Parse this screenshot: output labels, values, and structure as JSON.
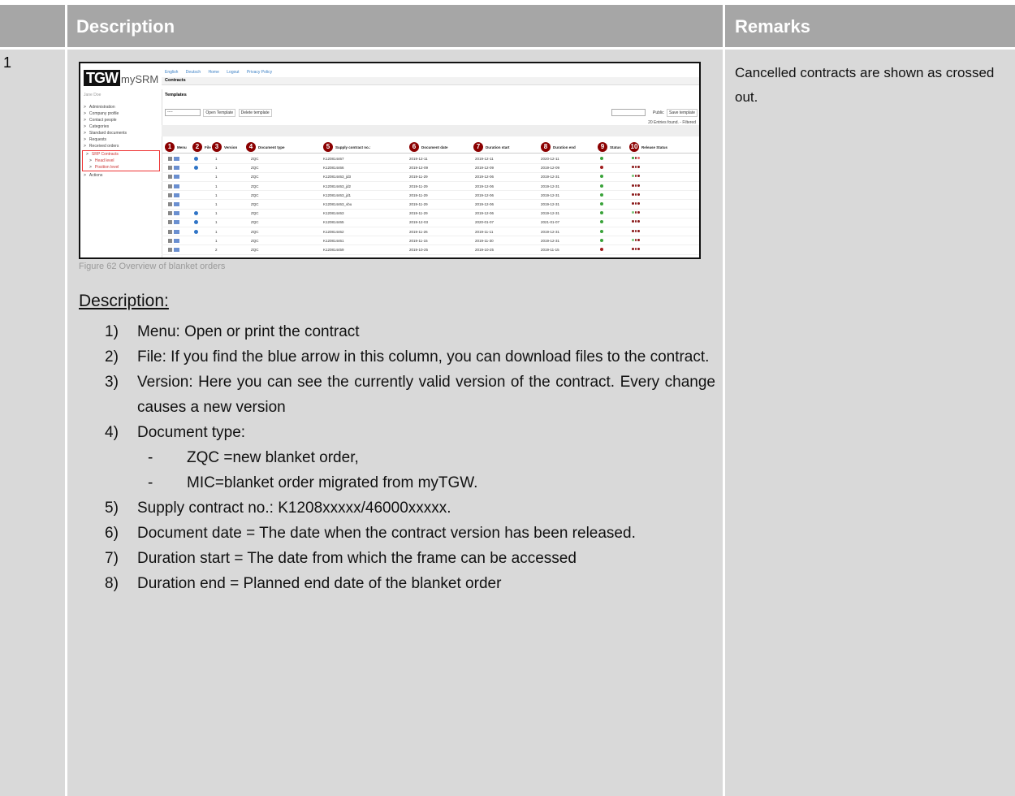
{
  "table": {
    "header_description": "Description",
    "header_remarks": "Remarks",
    "row_number": "1",
    "remark": "Cancelled contracts are shown as crossed out."
  },
  "screenshot": {
    "logo_tg": "TGW",
    "logo_my": "mySRM",
    "topnav": [
      "English",
      "Deutsch",
      "Home",
      "Logout",
      "Privacy Policy"
    ],
    "user": "Jane Doe",
    "sidebar": [
      "Administration",
      "Company profile",
      "Contact people",
      "Categories",
      "Standard documents",
      "Requests",
      "Received orders"
    ],
    "sidebar_box_title": "SRP Contracts",
    "sidebar_box_items": [
      "Head level",
      "Position level"
    ],
    "sidebar_after": "Actions",
    "contracts_title": "Contracts",
    "templates_title": "Templates",
    "select_value": "----",
    "open_template": "Open Template",
    "delete_template": "Delete template",
    "public_label": "Public",
    "save_template": "Save template",
    "entries_found": "20 Entries found. - Filtered",
    "columns": [
      {
        "badge": "1",
        "label": "Menu"
      },
      {
        "badge": "2",
        "label": "File"
      },
      {
        "badge": "3",
        "label": "Version"
      },
      {
        "badge": "4",
        "label": "Document type"
      },
      {
        "badge": "5",
        "label": "Supply contract no.:"
      },
      {
        "badge": "6",
        "label": "Document date"
      },
      {
        "badge": "7",
        "label": "Duration start"
      },
      {
        "badge": "8",
        "label": "Duration end"
      },
      {
        "badge": "9",
        "label": "Status"
      },
      {
        "badge": "10",
        "label": "Release Status"
      }
    ],
    "rows": [
      {
        "file": true,
        "version": "1",
        "type": "ZQC",
        "no": "K120814467",
        "date": "2019-12-11",
        "start": "2019-12-11",
        "end": "2020-12-11",
        "status": "#3aa33a",
        "release": [
          "#3aa33a",
          "#8b1a1a",
          "#e06b6b"
        ]
      },
      {
        "file": true,
        "version": "1",
        "type": "ZQC",
        "no": "K120814466",
        "date": "2019-12-09",
        "start": "2019-12-09",
        "end": "2019-12-09",
        "status": "#a01e1e",
        "release": [
          "#8b1a1a",
          "#8b1a1a",
          "#8b1a1a"
        ]
      },
      {
        "file": false,
        "version": "1",
        "type": "ZQC",
        "no": "K120814463_jd3",
        "date": "2019-11-29",
        "start": "2019-12-06",
        "end": "2019-12-31",
        "status": "#3aa33a",
        "release": [
          "#7bc77b",
          "#8b1a1a",
          "#8b1a1a"
        ]
      },
      {
        "file": false,
        "version": "1",
        "type": "ZQC",
        "no": "K120814463_jd2",
        "date": "2019-11-29",
        "start": "2019-12-06",
        "end": "2019-12-31",
        "status": "#3aa33a",
        "release": [
          "#8b1a1a",
          "#8b1a1a",
          "#8b1a1a"
        ]
      },
      {
        "file": false,
        "version": "1",
        "type": "ZQC",
        "no": "K120814463_jd1",
        "date": "2019-11-29",
        "start": "2019-12-06",
        "end": "2019-12-31",
        "status": "#3aa33a",
        "release": [
          "#8b1a1a",
          "#8b1a1a",
          "#8b1a1a"
        ]
      },
      {
        "file": false,
        "version": "1",
        "type": "ZQC",
        "no": "K120814463_vbu",
        "date": "2019-11-29",
        "start": "2019-12-06",
        "end": "2019-12-31",
        "status": "#3aa33a",
        "release": [
          "#8b1a1a",
          "#8b1a1a",
          "#8b1a1a"
        ]
      },
      {
        "file": true,
        "version": "1",
        "type": "ZQC",
        "no": "K120814463",
        "date": "2019-11-29",
        "start": "2019-12-06",
        "end": "2019-12-31",
        "status": "#3aa33a",
        "release": [
          "#7bc77b",
          "#8b1a1a",
          "#8b1a1a"
        ]
      },
      {
        "file": true,
        "version": "1",
        "type": "ZQC",
        "no": "K120814465",
        "date": "2019-12-03",
        "start": "2020-01-07",
        "end": "2021-01-07",
        "status": "#3aa33a",
        "release": [
          "#8b1a1a",
          "#8b1a1a",
          "#8b1a1a"
        ]
      },
      {
        "file": true,
        "version": "1",
        "type": "ZQC",
        "no": "K120814462",
        "date": "2019-11-26",
        "start": "2019-11-11",
        "end": "2019-12-31",
        "status": "#3aa33a",
        "release": [
          "#8b1a1a",
          "#8b1a1a",
          "#8b1a1a"
        ]
      },
      {
        "file": false,
        "version": "1",
        "type": "ZQC",
        "no": "K120814461",
        "date": "2019-11-15",
        "start": "2019-11-30",
        "end": "2019-12-31",
        "status": "#3aa33a",
        "release": [
          "#7bc77b",
          "#8b1a1a",
          "#8b1a1a"
        ]
      },
      {
        "file": false,
        "version": "2",
        "type": "ZQC",
        "no": "K120814459",
        "date": "2019-10-25",
        "start": "2019-10-25",
        "end": "2019-11-15",
        "status": "#a01e1e",
        "release": [
          "#8b1a1a",
          "#8b1a1a",
          "#8b1a1a"
        ]
      }
    ]
  },
  "caption": "Figure 62 Overview of blanket orders",
  "description_heading": "Description:",
  "items": [
    {
      "n": "1)",
      "t": "Menu: Open or print the contract"
    },
    {
      "n": "2)",
      "t": "File: If you find the blue arrow in this column, you can download files to the contract."
    },
    {
      "n": "3)",
      "t": "Version: Here you can see the currently valid version of the contract. Every change causes a new version"
    },
    {
      "n": "4)",
      "t": "Document type:"
    }
  ],
  "sub_items": [
    {
      "d": "-",
      "t": "ZQC =new blanket order,"
    },
    {
      "d": "-",
      "t": "MIC=blanket order migrated from myTGW."
    }
  ],
  "items2": [
    {
      "n": "5)",
      "t": "Supply contract no.: K1208xxxxx/46000xxxxx."
    },
    {
      "n": "6)",
      "t": "Document date = The date when the contract version has been released."
    },
    {
      "n": "7)",
      "t": "Duration start = The date from which the frame can be accessed"
    },
    {
      "n": "8)",
      "t": "Duration end = Planned end date of the blanket order"
    }
  ]
}
